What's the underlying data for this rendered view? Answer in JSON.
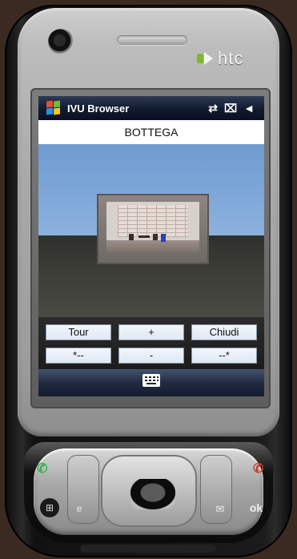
{
  "device": {
    "brand": "htc",
    "brand_color": "#7dbb2a"
  },
  "statusbar": {
    "app_title": "IVU Browser",
    "icons": [
      "windows-start-icon",
      "connectivity-icon",
      "battery-icon",
      "speaker-icon"
    ],
    "connectivity_glyph": "⇄",
    "battery_glyph": "⌧",
    "volume_glyph": "◄"
  },
  "caption": {
    "text": "BOTTEGA"
  },
  "buttons": {
    "row1": [
      {
        "label": "Tour"
      },
      {
        "label": "+"
      },
      {
        "label": "Chiudi"
      }
    ],
    "row2": [
      {
        "label": "*--"
      },
      {
        "label": "-"
      },
      {
        "label": "--*"
      }
    ]
  },
  "menubar": {
    "icon": "keyboard-icon"
  },
  "keypad": {
    "start_glyph": "⊞",
    "ok_label": "ok",
    "call_glyph": "✆",
    "end_glyph": "✆",
    "ie_glyph": "e",
    "mail_glyph": "✉"
  },
  "colors": {
    "status_bar": "#1a2338",
    "sky": "#8fb4e0",
    "ground": "#3c3c37",
    "button_face": "#e6eef7",
    "brand_green": "#7dbb2a"
  }
}
